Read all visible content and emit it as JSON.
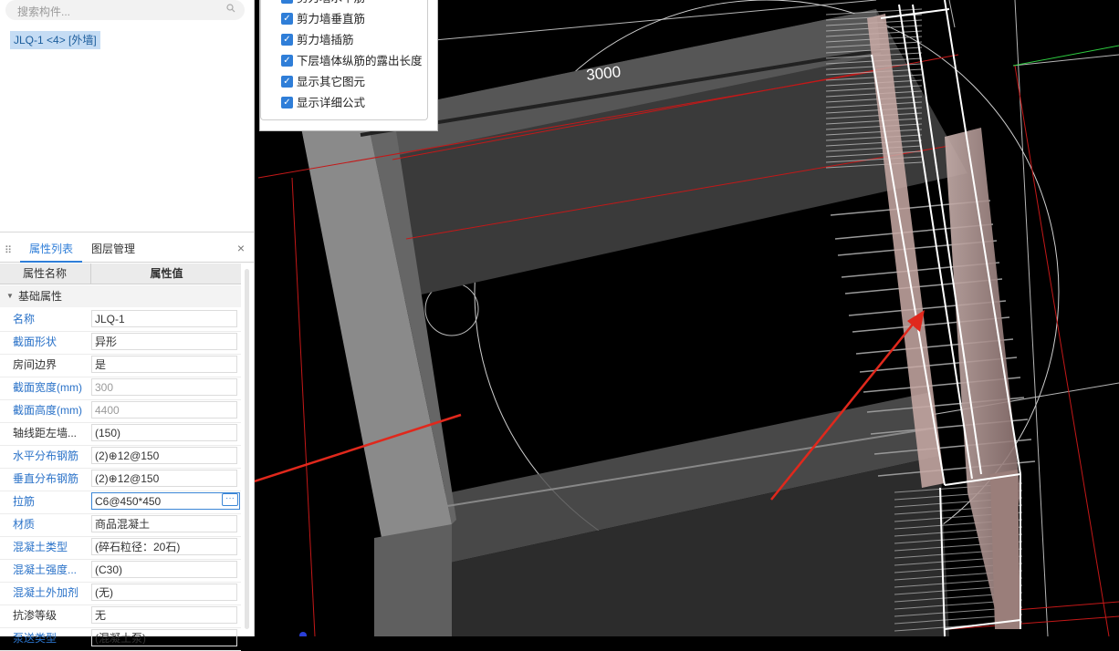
{
  "search": {
    "placeholder": "搜索构件..."
  },
  "component_list": [
    {
      "label": "JLQ-1 <4> [外墙]"
    }
  ],
  "tabs": {
    "properties": "属性列表",
    "layers": "图层管理",
    "close": "×"
  },
  "table_header": {
    "name_col": "属性名称",
    "value_col": "属性值"
  },
  "group_label": "基础属性",
  "properties": [
    {
      "name": "名称",
      "value": "JLQ-1",
      "name_blue": true,
      "gray": false
    },
    {
      "name": "截面形状",
      "value": "异形",
      "name_blue": true,
      "gray": false
    },
    {
      "name": "房间边界",
      "value": "是",
      "name_blue": false,
      "gray": false
    },
    {
      "name": "截面宽度(mm)",
      "value": "300",
      "name_blue": true,
      "gray": true
    },
    {
      "name": "截面高度(mm)",
      "value": "4400",
      "name_blue": true,
      "gray": true
    },
    {
      "name": "轴线距左墙...",
      "value": "(150)",
      "name_blue": false,
      "gray": false
    },
    {
      "name": "水平分布钢筋",
      "value": "(2)⊕12@150",
      "name_blue": true,
      "gray": false
    },
    {
      "name": "垂直分布钢筋",
      "value": "(2)⊕12@150",
      "name_blue": true,
      "gray": false
    },
    {
      "name": "拉筋",
      "value": "C6@450*450",
      "name_blue": true,
      "gray": false,
      "editing": true
    },
    {
      "name": "材质",
      "value": "商品混凝土",
      "name_blue": true,
      "gray": false
    },
    {
      "name": "混凝土类型",
      "value": "(碎石粒径：20石)",
      "name_blue": true,
      "gray": false
    },
    {
      "name": "混凝土强度...",
      "value": "(C30)",
      "name_blue": true,
      "gray": false
    },
    {
      "name": "混凝土外加剂",
      "value": "(无)",
      "name_blue": true,
      "gray": false
    },
    {
      "name": "抗渗等级",
      "value": "无",
      "name_blue": false,
      "gray": false
    },
    {
      "name": "泵送类型",
      "value": "(混凝土泵)",
      "name_blue": true,
      "gray": false
    }
  ],
  "edit_button": "···",
  "display_options": [
    {
      "label": "剪力墙水平筋",
      "checked": true
    },
    {
      "label": "剪力墙垂直筋",
      "checked": true
    },
    {
      "label": "剪力墙插筋",
      "checked": true
    },
    {
      "label": "下层墙体纵筋的露出长度",
      "checked": true
    },
    {
      "label": "显示其它图元",
      "checked": true
    },
    {
      "label": "显示详细公式",
      "checked": true
    }
  ],
  "viewport": {
    "dimension_label": "3000"
  },
  "colors": {
    "accent": "#2f7ed8",
    "annotation_arrow": "#e0281c",
    "red_boundary": "#c41818",
    "wall_fill": "#b09090"
  }
}
